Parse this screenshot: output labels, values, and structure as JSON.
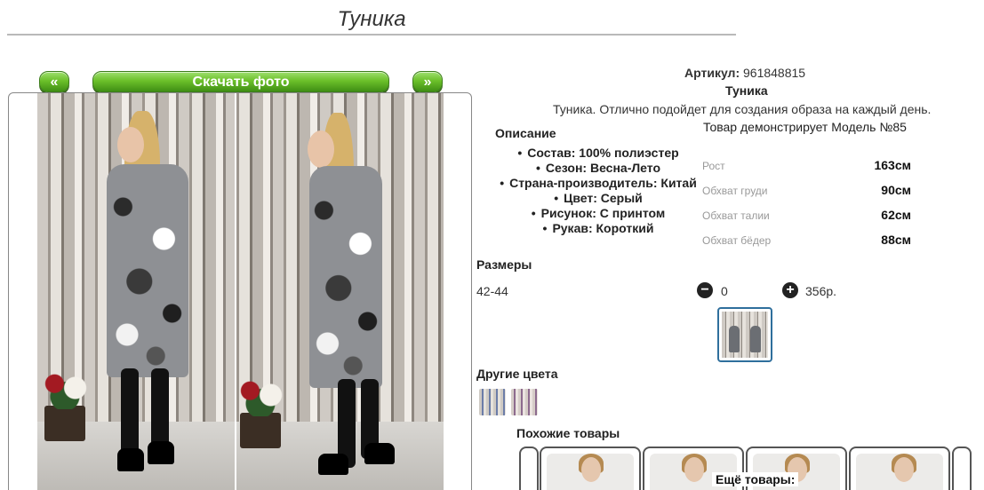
{
  "page": {
    "title": "Туника"
  },
  "gallery": {
    "prev_label": "«",
    "download_label": "Скачать фото",
    "next_label": "»"
  },
  "product": {
    "article_label": "Артикул:",
    "article_value": "961848815",
    "name": "Туника",
    "description": "Туника. Отлично подойдет для создания образа на каждый день.",
    "model_note": "Товар демонстрирует Модель №85"
  },
  "description_section": {
    "title": "Описание",
    "specs": [
      "Состав: 100% полиэстер",
      "Сезон: Весна-Лето",
      "Страна-производитель: Китай",
      "Цвет: Серый",
      "Рисунок: С принтом",
      "Рукав: Короткий"
    ]
  },
  "model_measurements": [
    {
      "label": "Рост",
      "value": "163см"
    },
    {
      "label": "Обхват груди",
      "value": "90см"
    },
    {
      "label": "Обхват талии",
      "value": "62см"
    },
    {
      "label": "Обхват бёдер",
      "value": "88см"
    }
  ],
  "sizes": {
    "title": "Размеры",
    "rows": [
      {
        "size": "42-44",
        "quantity": "0",
        "price": "356р."
      }
    ],
    "minus_icon": "minus-circle-icon",
    "plus_icon": "plus-circle-icon"
  },
  "other_colors": {
    "title": "Другие цвета"
  },
  "similar": {
    "title": "Похожие товары",
    "more_label": "Ещё товары:"
  }
}
